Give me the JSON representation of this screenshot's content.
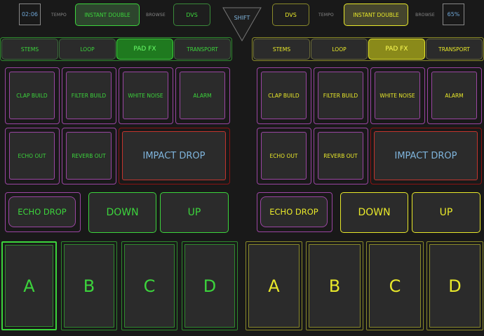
{
  "top": {
    "time": "02:06",
    "tempo_left": "TEMPO",
    "fx_left": "INSTANT DOUBLE",
    "browse_left": "BROWSE",
    "dvs_left": "DVS",
    "shift": "SHIFT",
    "dvs_right": "DVS",
    "tempo_right": "TEMPO",
    "fx_right": "INSTANT DOUBLE",
    "browse_right": "BROWSE",
    "volume": "65%"
  },
  "left": {
    "tabs": [
      "STEMS",
      "LOOP",
      "PAD FX",
      "TRANSPORT"
    ],
    "pads": [
      "CLAP BUILD",
      "FILTER BUILD",
      "WHITE NOISE",
      "ALARM",
      "ECHO OUT",
      "REVERB OUT"
    ],
    "impact": "IMPACT DROP",
    "echo_drop": "ECHO DROP",
    "down": "DOWN",
    "up": "UP",
    "cues": [
      "A",
      "B",
      "C",
      "D"
    ]
  },
  "right": {
    "tabs": [
      "STEMS",
      "LOOP",
      "PAD FX",
      "TRANSPORT"
    ],
    "pads": [
      "CLAP BUILD",
      "FILTER BUILD",
      "WHITE NOISE",
      "ALARM",
      "ECHO OUT",
      "REVERB OUT"
    ],
    "impact": "IMPACT DROP",
    "echo_drop": "ECHO DROP",
    "down": "DOWN",
    "up": "UP",
    "cues": [
      "A",
      "B",
      "C",
      "D"
    ]
  },
  "colors": {
    "left_accent": "#3cd43c",
    "right_accent": "#e8e82a",
    "purple_frame": "#9a45a2",
    "red_frame": "#8b1414",
    "impact_text": "#7fb4dc",
    "time_text": "#6fa6d6"
  }
}
